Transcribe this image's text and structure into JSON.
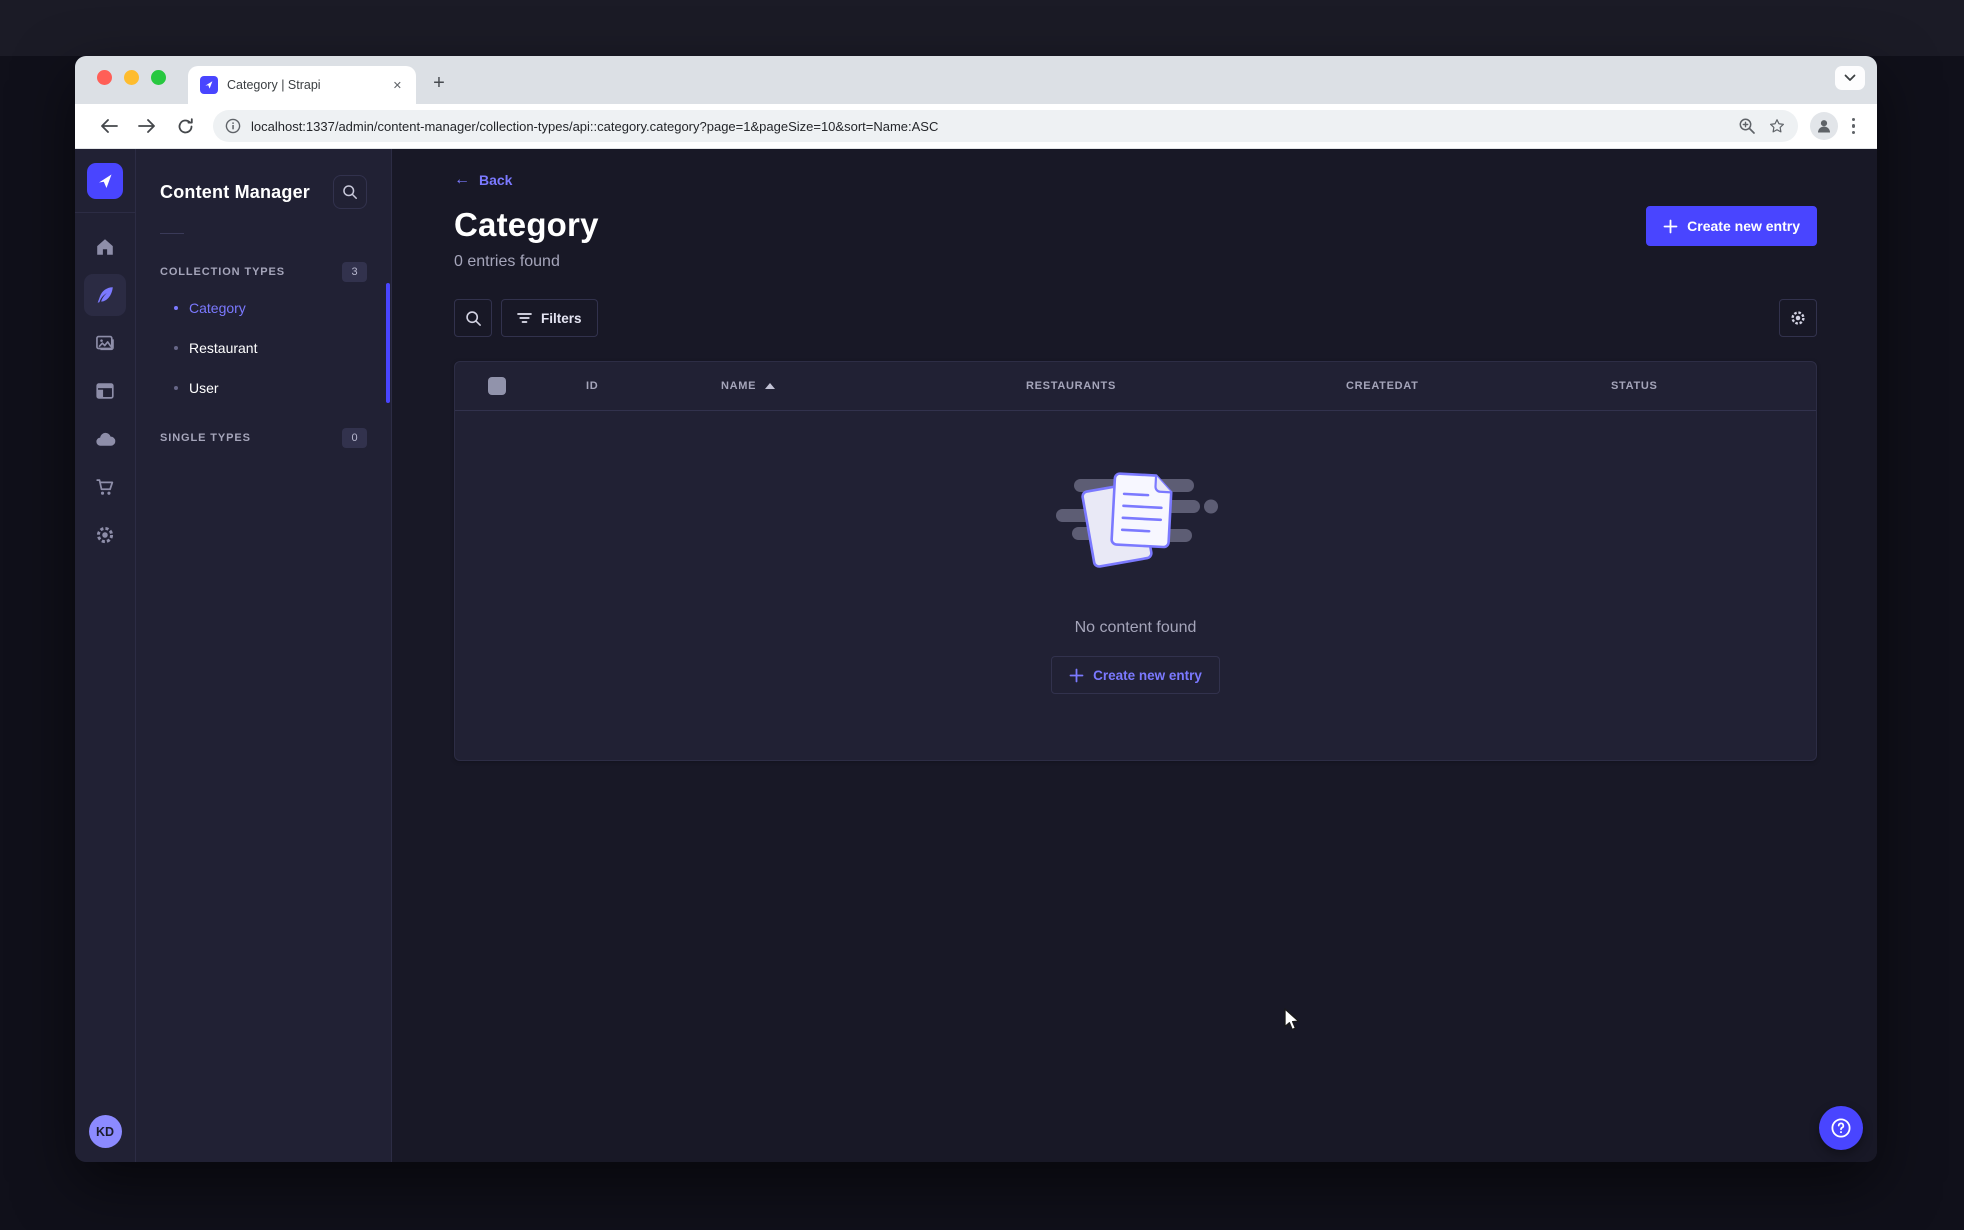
{
  "colors": {
    "primary": "#4945ff",
    "primary_light": "#7b79ff",
    "page_bg": "#181826",
    "card_bg": "#212134",
    "border": "#32324d",
    "text_muted": "#a5a5ba"
  },
  "browser": {
    "tab_title": "Category | Strapi",
    "new_tab_label": "+",
    "url": "localhost:1337/admin/content-manager/collection-types/api::category.category?page=1&pageSize=10&sort=Name:ASC"
  },
  "nav": {
    "avatar_initials": "KD"
  },
  "subnav": {
    "title": "Content Manager",
    "collection_types": {
      "label": "COLLECTION TYPES",
      "badge": "3",
      "items": [
        {
          "label": "Category",
          "active": true
        },
        {
          "label": "Restaurant",
          "active": false
        },
        {
          "label": "User",
          "active": false
        }
      ]
    },
    "single_types": {
      "label": "SINGLE TYPES",
      "badge": "0"
    }
  },
  "main": {
    "back_label": "Back",
    "title": "Category",
    "entries_found": "0 entries found",
    "create_button": "Create new entry",
    "filters_button": "Filters",
    "table": {
      "columns": [
        "ID",
        "NAME",
        "RESTAURANTS",
        "CREATEDAT",
        "STATUS"
      ],
      "sorted_column": "NAME",
      "sort_direction": "ASC",
      "rows": []
    },
    "empty_state": {
      "message": "No content found",
      "create_button": "Create new entry"
    }
  }
}
